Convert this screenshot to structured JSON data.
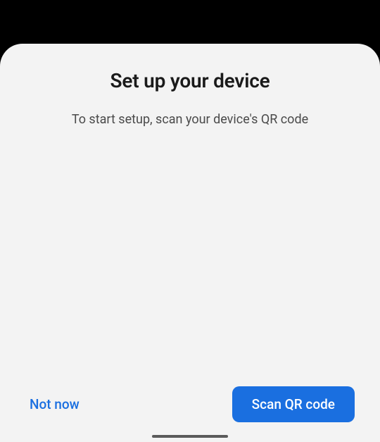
{
  "dialog": {
    "title": "Set up your device",
    "subtitle": "To start setup, scan your device's QR code"
  },
  "buttons": {
    "not_now": "Not now",
    "scan": "Scan QR code"
  }
}
